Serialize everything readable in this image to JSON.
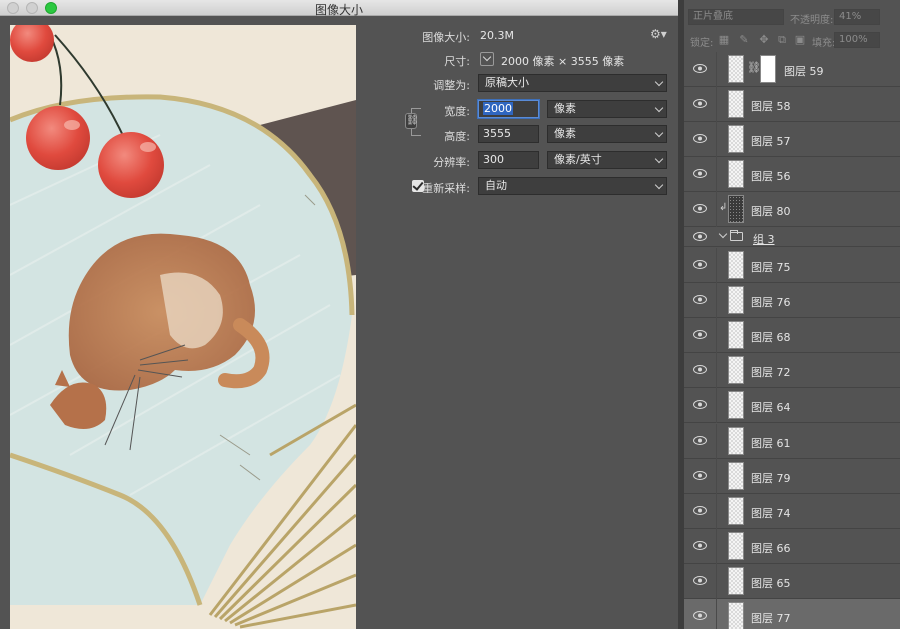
{
  "window": {
    "title": "图像大小"
  },
  "image_size": {
    "size_label": "图像大小:",
    "size_value": "20.3M",
    "dimensions_label": "尺寸:",
    "dimensions_value": "2000 像素  ×  3555 像素",
    "fit_to_label": "调整为:",
    "fit_to_value": "原稿大小",
    "width_label": "宽度:",
    "width_value": "2000",
    "width_unit": "像素",
    "height_label": "高度:",
    "height_value": "3555",
    "height_unit": "像素",
    "resolution_label": "分辨率:",
    "resolution_value": "300",
    "resolution_unit": "像素/英寸",
    "resample_label": "重新采样:",
    "resample_value": "自动"
  },
  "layers_panel": {
    "blend_mode": "正片叠底",
    "opacity_label": "不透明度:",
    "opacity_value": "41%",
    "lock_label": "锁定:",
    "fill_label": "填充:",
    "fill_value": "100%",
    "group_name": "组 3",
    "layers_before_group": [
      {
        "name": "图层 59",
        "has_mask": true
      },
      {
        "name": "图层 58"
      },
      {
        "name": "图层 57"
      },
      {
        "name": "图层 56"
      },
      {
        "name": "图层 80",
        "clipped": true,
        "dark": true
      }
    ],
    "layers_in_group": [
      {
        "name": "图层 75"
      },
      {
        "name": "图层 76"
      },
      {
        "name": "图层 68"
      },
      {
        "name": "图层 72"
      },
      {
        "name": "图层 64"
      },
      {
        "name": "图层 61"
      },
      {
        "name": "图层 79"
      },
      {
        "name": "图层 74"
      },
      {
        "name": "图层 66"
      },
      {
        "name": "图层 65"
      },
      {
        "name": "图层 77",
        "selected": true
      }
    ]
  }
}
